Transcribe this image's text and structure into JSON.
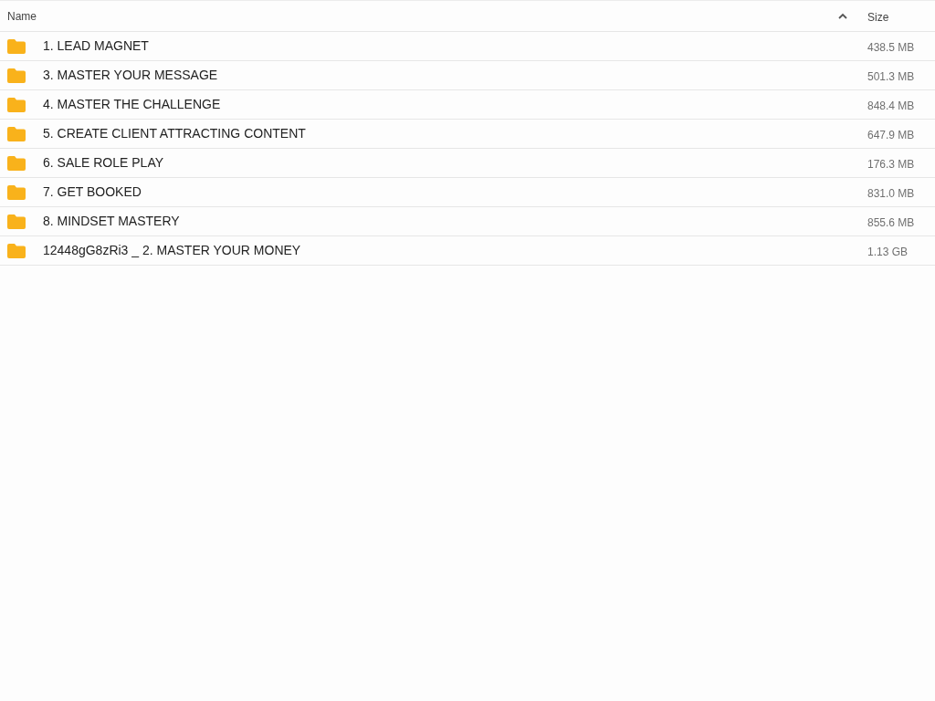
{
  "table": {
    "columns": [
      {
        "label": "Name",
        "sorted": true
      },
      {
        "label": "Size",
        "sorted": false
      }
    ],
    "rows": [
      {
        "kind": "folder",
        "name": "1. LEAD MAGNET",
        "size": "438.5 MB"
      },
      {
        "kind": "folder",
        "name": "3. MASTER YOUR MESSAGE",
        "size": "501.3 MB"
      },
      {
        "kind": "folder",
        "name": "4. MASTER THE CHALLENGE",
        "size": "848.4 MB"
      },
      {
        "kind": "folder",
        "name": "5. CREATE CLIENT ATTRACTING CONTENT",
        "size": "647.9 MB"
      },
      {
        "kind": "folder",
        "name": "6. SALE ROLE PLAY",
        "size": "176.3 MB"
      },
      {
        "kind": "folder",
        "name": "7. GET BOOKED",
        "size": "831.0 MB"
      },
      {
        "kind": "folder",
        "name": "8. MINDSET MASTERY",
        "size": "855.6 MB"
      },
      {
        "kind": "folder",
        "name": "12448gG8zRi3 _ 2. MASTER YOUR MONEY",
        "size": "1.13 GB"
      }
    ]
  }
}
